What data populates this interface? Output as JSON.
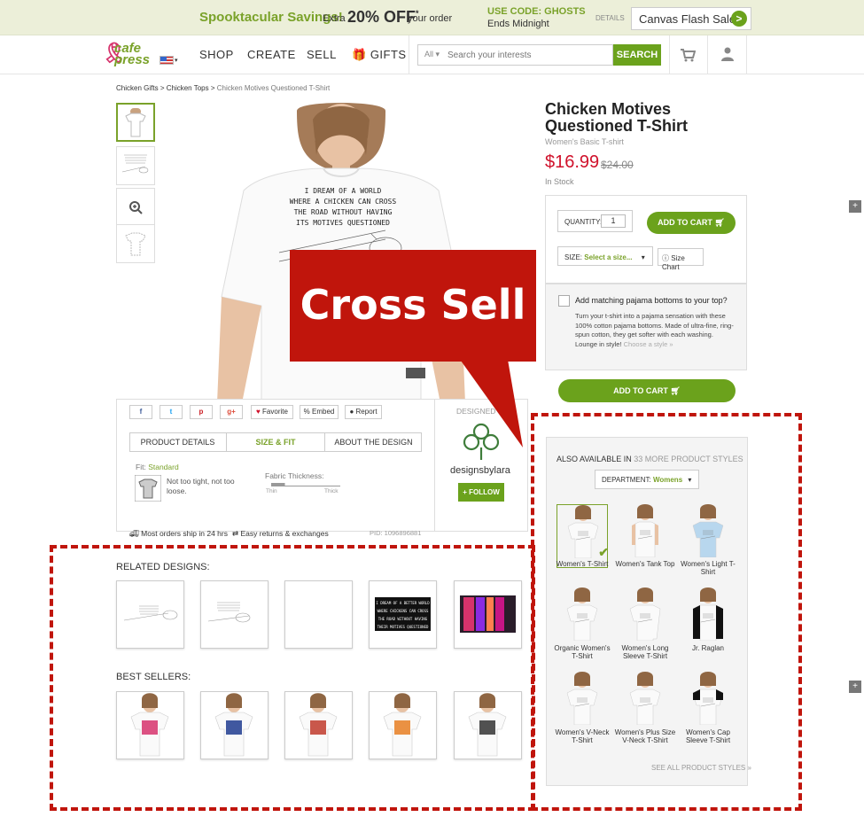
{
  "promo": {
    "headline": "Spooktacular Savings!",
    "extra": "Extra",
    "discount": "20% OFF",
    "asterisk": "*",
    "your_order": "your order",
    "code_label": "USE CODE: GHOSTS",
    "ends": "Ends Midnight",
    "details": "DETAILS",
    "flash_sale": "Canvas Flash Sale",
    "flash_go": ">"
  },
  "nav": {
    "logo_line1": "cafe",
    "logo_line2": "press",
    "links": [
      "SHOP",
      "CREATE",
      "SELL",
      "GIFTS"
    ],
    "search_scope": "All",
    "search_placeholder": "Search your interests",
    "search_button": "SEARCH"
  },
  "breadcrumb": {
    "items": [
      "Chicken Gifts",
      "Chicken Tops",
      "Chicken Motives Questioned T-Shirt"
    ],
    "sep": ">"
  },
  "product": {
    "shirt_text": [
      "I DREAM OF A WORLD",
      "WHERE A CHICKEN CAN CROSS",
      "THE ROAD WITHOUT HAVING",
      "ITS MOTIVES QUESTIONED"
    ],
    "title": "Chicken Motives Questioned T-Shirt",
    "subtitle": "Women's Basic T-shirt",
    "price": "$16.99",
    "old_price": "$24.00",
    "stock": "In Stock",
    "quantity_label": "QUANTITY:",
    "quantity": "1",
    "add_to_cart": "ADD TO CART",
    "size_label": "SIZE:",
    "size_value": "Select a size...",
    "size_chart": "Size Chart",
    "pajama_title": "Add matching pajama bottoms to your top?",
    "pajama_text": "Turn your t-shirt into a pajama sensation with these 100% cotton pajama bottoms. Made of ultra-fine, ring-spun cotton, they get softer with each washing. Lounge in style!",
    "pajama_link": "Choose a style »",
    "add_to_cart_2": "ADD TO CART"
  },
  "callout": {
    "text": "Cross Sell",
    "color": "#c0150c"
  },
  "social": {
    "buttons": [
      "f",
      "t",
      "p",
      "g+",
      "Favorite",
      "Embed",
      "Report"
    ],
    "tabs": [
      "PRODUCT DETAILS",
      "SIZE & FIT",
      "ABOUT THE DESIGN"
    ],
    "fit_label": "Fit:",
    "fit_value": "Standard",
    "fit_desc": "Not too tight, not too loose.",
    "thickness_label": "Fabric Thickness:",
    "thin": "Thin",
    "thick": "Thick",
    "ship": "Most orders ship in 24 hrs",
    "returns": "Easy returns & exchanges",
    "pid": "PID: 1096896881"
  },
  "designer": {
    "label": "DESIGNED",
    "name": "designsbylara",
    "follow": "+ FOLLOW"
  },
  "styles": {
    "heading_pre": "ALSO AVAILABLE IN",
    "heading_count": "33 MORE PRODUCT STYLES",
    "department_label": "DEPARTMENT:",
    "department_value": "Womens",
    "items": [
      "Women's T-Shirt",
      "Women's Tank Top",
      "Women's Light T-Shirt",
      "Organic Women's T-Shirt",
      "Women's Long Sleeve T-Shirt",
      "Jr. Raglan",
      "Women's V-Neck T-Shirt",
      "Women's Plus Size V-Neck T-Shirt",
      "Women's Cap Sleeve T-Shirt"
    ],
    "see_all": "SEE ALL PRODUCT STYLES »"
  },
  "related": {
    "heading": "RELATED DESIGNS:",
    "dark_text": [
      "I DREAM OF A BETTER WORLD",
      "WHERE CHICKENS CAN CROSS",
      "THE ROAD WITHOUT HAVING",
      "THEIR MOTIVES QUESTIONED"
    ]
  },
  "bestsellers": {
    "heading": "BEST SELLERS:"
  },
  "colors": {
    "green": "#6ba21c",
    "red_price": "#d0112b",
    "callout_red": "#c0150c"
  }
}
